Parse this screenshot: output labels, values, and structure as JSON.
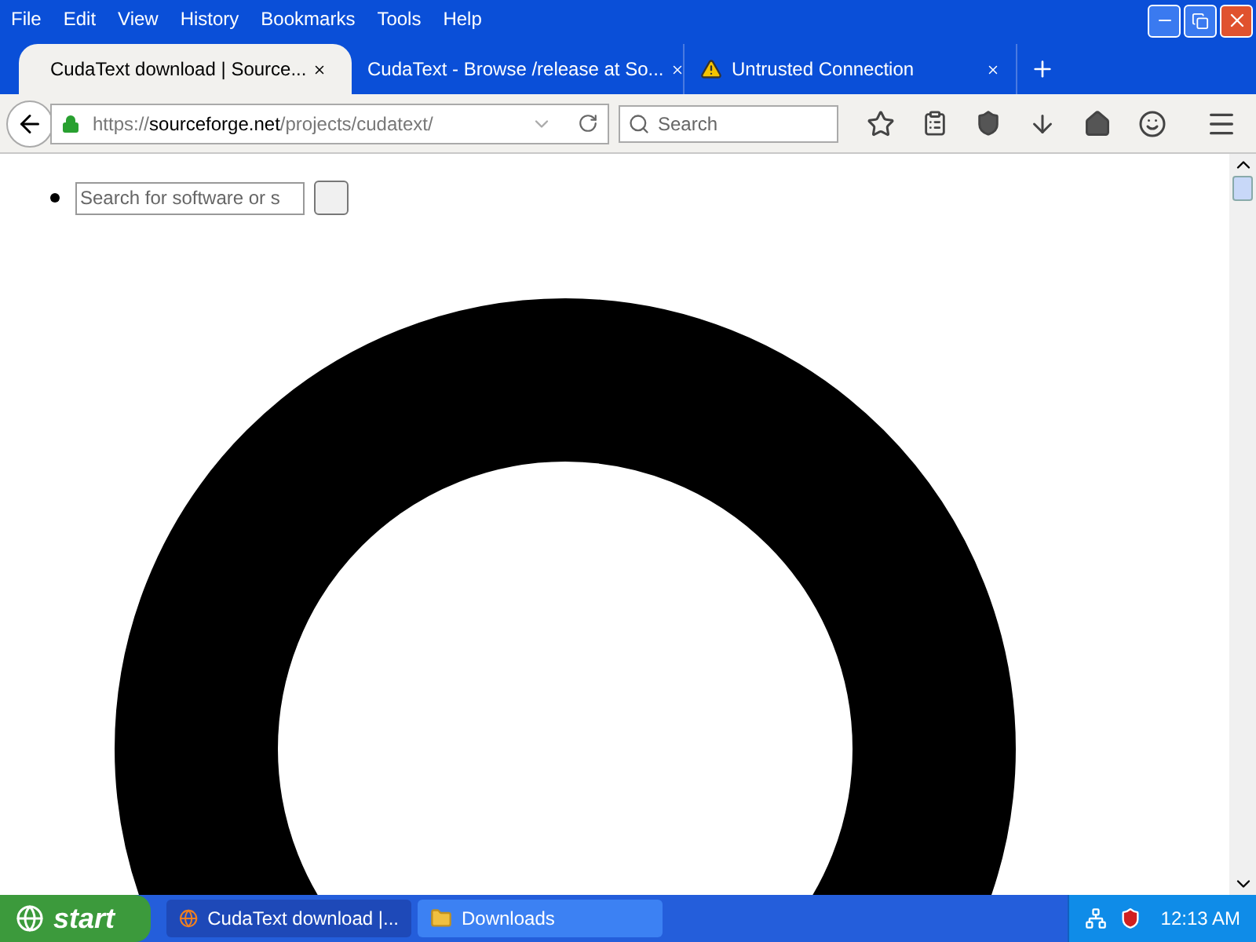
{
  "menu": [
    "File",
    "Edit",
    "View",
    "History",
    "Bookmarks",
    "Tools",
    "Help"
  ],
  "tabs": [
    {
      "title": "CudaText download | Source...",
      "selected": true,
      "warning": false
    },
    {
      "title": "CudaText - Browse /release at So...",
      "selected": false,
      "warning": false
    },
    {
      "title": "Untrusted Connection",
      "selected": false,
      "warning": true
    }
  ],
  "url": {
    "scheme": "https://",
    "host": "sourceforge.net",
    "path": "/projects/cudatext/"
  },
  "search": {
    "placeholder": "Search"
  },
  "page": {
    "search_placeholder": "Search for software or s"
  },
  "taskbar": {
    "start": "start",
    "tasks": [
      {
        "label": "CudaText download |...",
        "kind": "browser",
        "selected": true
      },
      {
        "label": "Downloads",
        "kind": "folder",
        "selected": false
      }
    ],
    "clock": "12:13 AM"
  }
}
